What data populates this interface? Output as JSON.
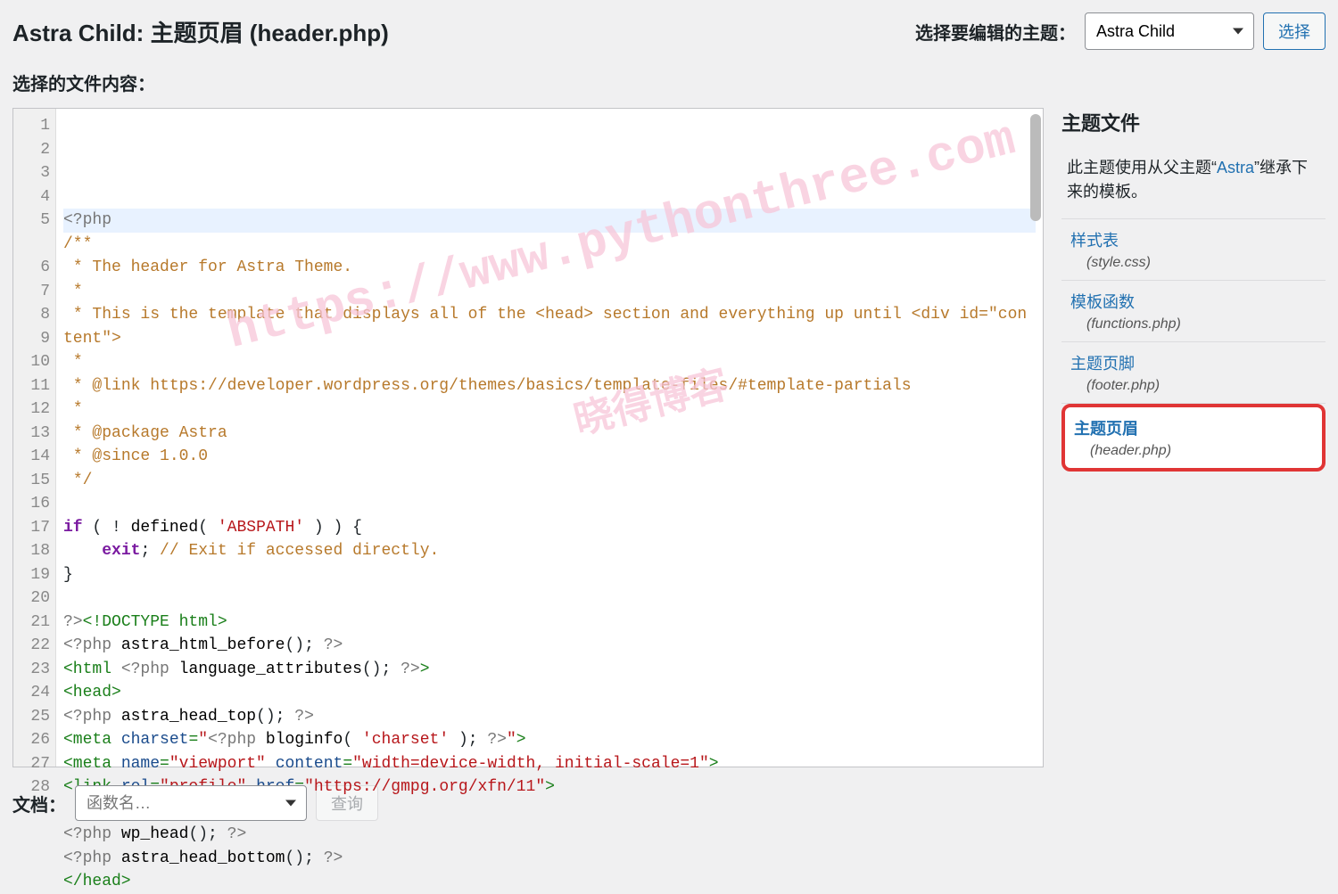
{
  "header": {
    "title": "Astra Child: 主题页眉 (header.php)",
    "select_label": "选择要编辑的主题：",
    "selected_theme": "Astra Child",
    "select_button": "选择"
  },
  "content_label": "选择的文件内容：",
  "code": {
    "lines": [
      "<?php",
      "/**",
      " * The header for Astra Theme.",
      " *",
      " * This is the template that displays all of the <head> section and everything up until <div id=\"content\">",
      " *",
      " * @link https://developer.wordpress.org/themes/basics/template-files/#template-partials",
      " *",
      " * @package Astra",
      " * @since 1.0.0",
      " */",
      "",
      "if ( ! defined( 'ABSPATH' ) ) {",
      "    exit; // Exit if accessed directly.",
      "}",
      "",
      "?><!DOCTYPE html>",
      "<?php astra_html_before(); ?>",
      "<html <?php language_attributes(); ?>>",
      "<head>",
      "<?php astra_head_top(); ?>",
      "<meta charset=\"<?php bloginfo( 'charset' ); ?>\">",
      "<meta name=\"viewport\" content=\"width=device-width, initial-scale=1\">",
      "<link rel=\"profile\" href=\"https://gmpg.org/xfn/11\">",
      "",
      "<?php wp_head(); ?>",
      "<?php astra_head_bottom(); ?>",
      "</head>"
    ],
    "line_count": 28
  },
  "watermark": {
    "url": "https://www.pythonthree.com",
    "text": "晓得博客"
  },
  "sidebar": {
    "title": "主题文件",
    "info_prefix": "此主题使用从父主题“",
    "info_link": "Astra",
    "info_suffix": "”继承下来的模板。",
    "files": [
      {
        "name": "样式表",
        "sub": "(style.css)",
        "active": false
      },
      {
        "name": "模板函数",
        "sub": "(functions.php)",
        "active": false
      },
      {
        "name": "主题页脚",
        "sub": "(footer.php)",
        "active": false
      },
      {
        "name": "主题页眉",
        "sub": "(header.php)",
        "active": true
      }
    ]
  },
  "footer": {
    "label": "文档：",
    "placeholder": "函数名…",
    "lookup_button": "查询"
  }
}
